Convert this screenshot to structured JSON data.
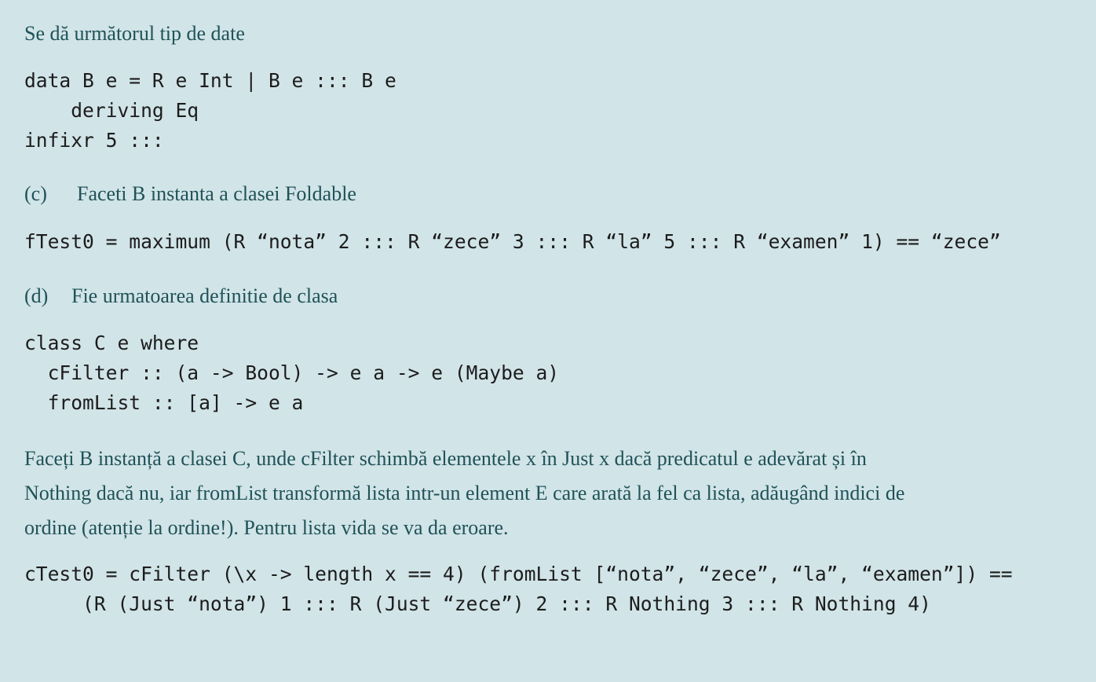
{
  "intro": "Se dă următorul tip de date",
  "data_decl": {
    "line1": "data B e = R e Int | B e ::: B e",
    "line2": "    deriving Eq",
    "line3": "infixr 5 :::"
  },
  "item_c": {
    "label": "(c)",
    "text": "Faceti B instanta a clasei Foldable"
  },
  "ftest": "fTest0 = maximum (R “nota” 2 ::: R “zece” 3 ::: R “la” 5 ::: R “examen” 1) == “zece”",
  "item_d": {
    "label": "(d)",
    "text": "Fie urmatoarea definitie de clasa"
  },
  "class_decl": {
    "line1": "class C e where",
    "line2": "  cFilter :: (a -> Bool) -> e a -> e (Maybe a)",
    "line3": "  fromList :: [a] -> e a"
  },
  "paragraph": {
    "line1": "Faceți B instanță a clasei C, unde cFilter schimbă elementele x în Just x dacă predicatul e adevărat și în",
    "line2": "Nothing dacă nu, iar fromList transformă lista intr-un element E care arată la fel ca lista, adăugând indici de",
    "line3": "ordine (atenție la ordine!). Pentru lista vida se va da eroare."
  },
  "ctest": {
    "line1": "cTest0 = cFilter (\\x -> length x == 4) (fromList [“nota”, “zece”, “la”, “examen”]) ==",
    "line2": "     (R (Just “nota”) 1 ::: R (Just “zece”) 2 ::: R Nothing 3 ::: R Nothing 4)"
  }
}
